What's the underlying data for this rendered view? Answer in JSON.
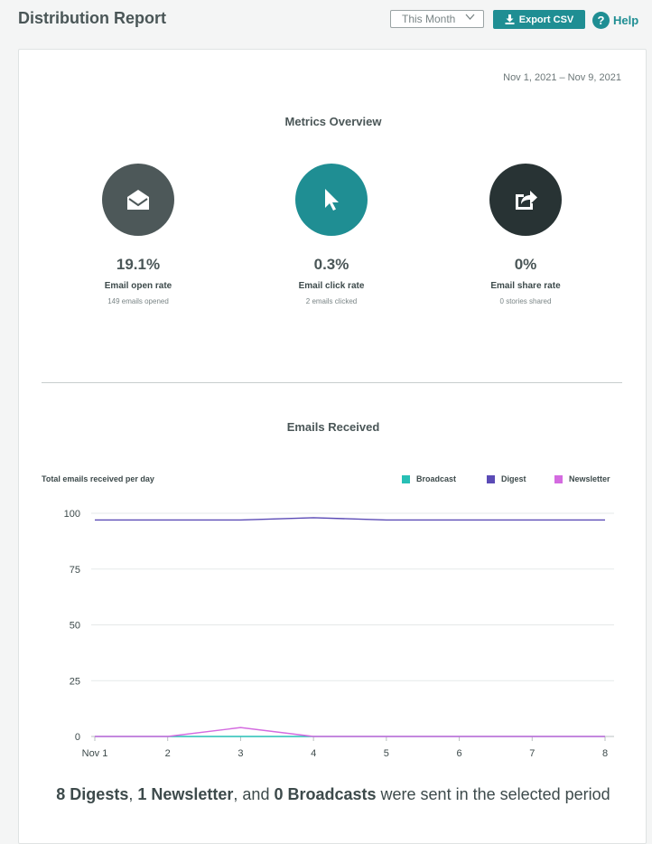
{
  "header": {
    "title": "Distribution Report",
    "period_select": "This Month",
    "export_label": "Export CSV",
    "help_label": "Help",
    "help_glyph": "?"
  },
  "report": {
    "date_range": "Nov 1, 2021 – Nov 9, 2021",
    "metrics_title": "Metrics Overview",
    "metrics": [
      {
        "icon": "open-envelope-icon",
        "color": "#4d5859",
        "value": "19.1%",
        "label": "Email open rate",
        "sub": "149 emails opened"
      },
      {
        "icon": "cursor-pointer-icon",
        "color": "#1f8e93",
        "value": "0.3%",
        "label": "Email click rate",
        "sub": "2 emails clicked"
      },
      {
        "icon": "share-icon",
        "color": "#283334",
        "value": "0%",
        "label": "Email share rate",
        "sub": "0 stories shared"
      }
    ],
    "emails_title": "Emails Received",
    "chart_caption": "Total emails received per day",
    "summary": {
      "digests": "8 Digests",
      "sep1": ", ",
      "newsletters": "1 Newsletter",
      "sep2": ", and ",
      "broadcasts": "0 Broadcasts",
      "tail": " were sent in the selected period"
    }
  },
  "chart_data": {
    "type": "line",
    "title": "Emails Received",
    "ylabel": "Total emails received per day",
    "x": [
      "Nov 1",
      "2",
      "3",
      "4",
      "5",
      "6",
      "7",
      "8"
    ],
    "ylim": [
      0,
      100
    ],
    "yticks": [
      0,
      25,
      50,
      75,
      100
    ],
    "grid": true,
    "legend": "top-right",
    "series": [
      {
        "name": "Broadcast",
        "color": "#27bfb5",
        "values": [
          0,
          0,
          0,
          0,
          0,
          0,
          0,
          0
        ]
      },
      {
        "name": "Digest",
        "color": "#5b4bb6",
        "values": [
          97,
          97,
          97,
          98,
          97,
          97,
          97,
          97
        ]
      },
      {
        "name": "Newsletter",
        "color": "#d46be0",
        "values": [
          0,
          0,
          4,
          0,
          0,
          0,
          0,
          0
        ]
      }
    ]
  }
}
